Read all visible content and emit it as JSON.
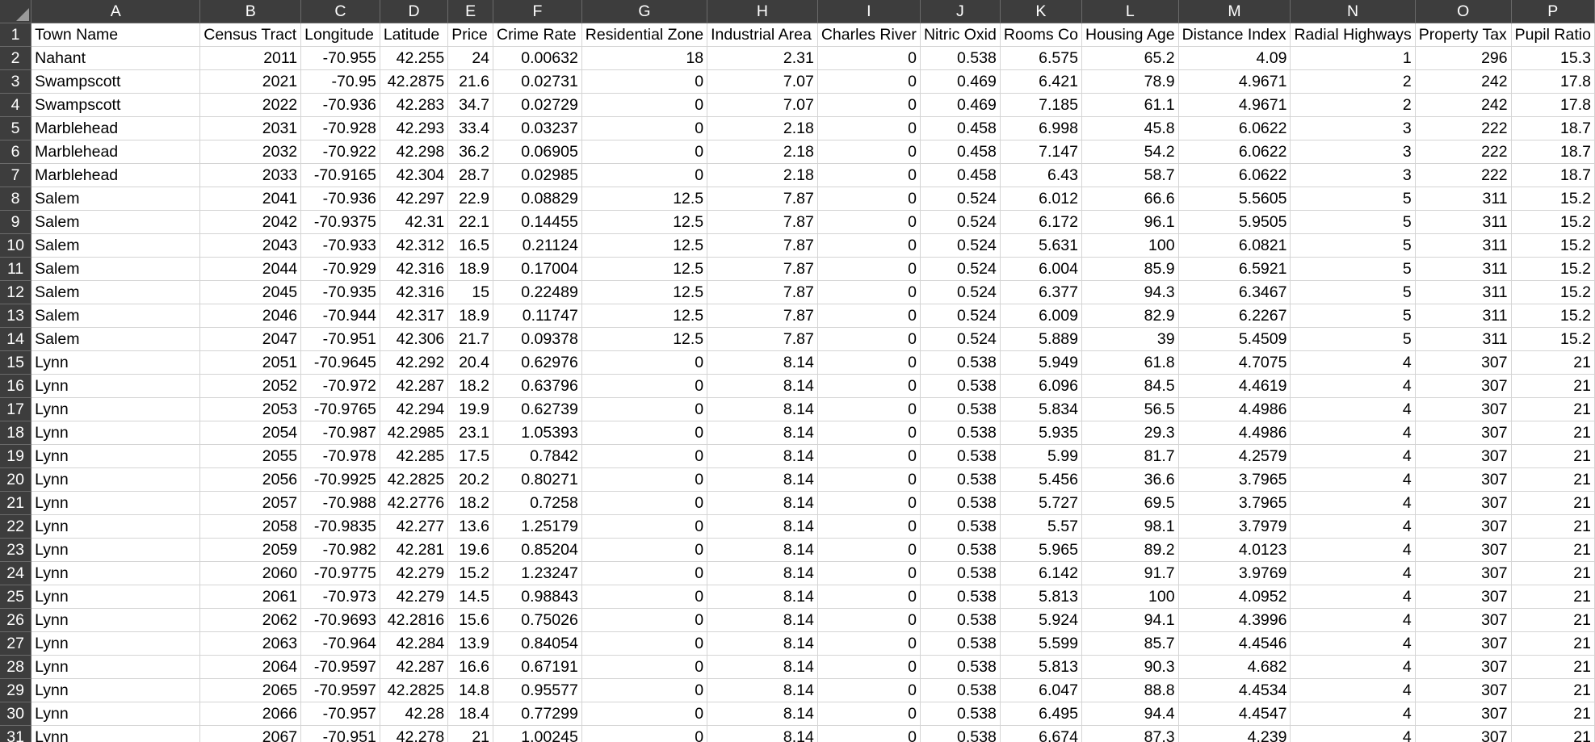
{
  "sheet": {
    "corner": "",
    "columns": [
      "A",
      "B",
      "C",
      "D",
      "E",
      "F",
      "G",
      "H",
      "I",
      "J",
      "K",
      "L",
      "M",
      "N",
      "O",
      "P"
    ],
    "rows": [
      [
        "Town Name",
        "Census Tract",
        "Longitude",
        "Latitude",
        "Price",
        "Crime Rate",
        "Residential Zone",
        "Industrial Area",
        "Charles River",
        "Nitric Oxid",
        "Rooms Co",
        "Housing Age",
        "Distance Index",
        "Radial Highways",
        "Property Tax",
        "Pupil Ratio"
      ],
      [
        "Nahant",
        "2011",
        "-70.955",
        "42.255",
        "24",
        "0.00632",
        "18",
        "2.31",
        "0",
        "0.538",
        "6.575",
        "65.2",
        "4.09",
        "1",
        "296",
        "15.3"
      ],
      [
        "Swampscott",
        "2021",
        "-70.95",
        "42.2875",
        "21.6",
        "0.02731",
        "0",
        "7.07",
        "0",
        "0.469",
        "6.421",
        "78.9",
        "4.9671",
        "2",
        "242",
        "17.8"
      ],
      [
        "Swampscott",
        "2022",
        "-70.936",
        "42.283",
        "34.7",
        "0.02729",
        "0",
        "7.07",
        "0",
        "0.469",
        "7.185",
        "61.1",
        "4.9671",
        "2",
        "242",
        "17.8"
      ],
      [
        "Marblehead",
        "2031",
        "-70.928",
        "42.293",
        "33.4",
        "0.03237",
        "0",
        "2.18",
        "0",
        "0.458",
        "6.998",
        "45.8",
        "6.0622",
        "3",
        "222",
        "18.7"
      ],
      [
        "Marblehead",
        "2032",
        "-70.922",
        "42.298",
        "36.2",
        "0.06905",
        "0",
        "2.18",
        "0",
        "0.458",
        "7.147",
        "54.2",
        "6.0622",
        "3",
        "222",
        "18.7"
      ],
      [
        "Marblehead",
        "2033",
        "-70.9165",
        "42.304",
        "28.7",
        "0.02985",
        "0",
        "2.18",
        "0",
        "0.458",
        "6.43",
        "58.7",
        "6.0622",
        "3",
        "222",
        "18.7"
      ],
      [
        "Salem",
        "2041",
        "-70.936",
        "42.297",
        "22.9",
        "0.08829",
        "12.5",
        "7.87",
        "0",
        "0.524",
        "6.012",
        "66.6",
        "5.5605",
        "5",
        "311",
        "15.2"
      ],
      [
        "Salem",
        "2042",
        "-70.9375",
        "42.31",
        "22.1",
        "0.14455",
        "12.5",
        "7.87",
        "0",
        "0.524",
        "6.172",
        "96.1",
        "5.9505",
        "5",
        "311",
        "15.2"
      ],
      [
        "Salem",
        "2043",
        "-70.933",
        "42.312",
        "16.5",
        "0.21124",
        "12.5",
        "7.87",
        "0",
        "0.524",
        "5.631",
        "100",
        "6.0821",
        "5",
        "311",
        "15.2"
      ],
      [
        "Salem",
        "2044",
        "-70.929",
        "42.316",
        "18.9",
        "0.17004",
        "12.5",
        "7.87",
        "0",
        "0.524",
        "6.004",
        "85.9",
        "6.5921",
        "5",
        "311",
        "15.2"
      ],
      [
        "Salem",
        "2045",
        "-70.935",
        "42.316",
        "15",
        "0.22489",
        "12.5",
        "7.87",
        "0",
        "0.524",
        "6.377",
        "94.3",
        "6.3467",
        "5",
        "311",
        "15.2"
      ],
      [
        "Salem",
        "2046",
        "-70.944",
        "42.317",
        "18.9",
        "0.11747",
        "12.5",
        "7.87",
        "0",
        "0.524",
        "6.009",
        "82.9",
        "6.2267",
        "5",
        "311",
        "15.2"
      ],
      [
        "Salem",
        "2047",
        "-70.951",
        "42.306",
        "21.7",
        "0.09378",
        "12.5",
        "7.87",
        "0",
        "0.524",
        "5.889",
        "39",
        "5.4509",
        "5",
        "311",
        "15.2"
      ],
      [
        "Lynn",
        "2051",
        "-70.9645",
        "42.292",
        "20.4",
        "0.62976",
        "0",
        "8.14",
        "0",
        "0.538",
        "5.949",
        "61.8",
        "4.7075",
        "4",
        "307",
        "21"
      ],
      [
        "Lynn",
        "2052",
        "-70.972",
        "42.287",
        "18.2",
        "0.63796",
        "0",
        "8.14",
        "0",
        "0.538",
        "6.096",
        "84.5",
        "4.4619",
        "4",
        "307",
        "21"
      ],
      [
        "Lynn",
        "2053",
        "-70.9765",
        "42.294",
        "19.9",
        "0.62739",
        "0",
        "8.14",
        "0",
        "0.538",
        "5.834",
        "56.5",
        "4.4986",
        "4",
        "307",
        "21"
      ],
      [
        "Lynn",
        "2054",
        "-70.987",
        "42.2985",
        "23.1",
        "1.05393",
        "0",
        "8.14",
        "0",
        "0.538",
        "5.935",
        "29.3",
        "4.4986",
        "4",
        "307",
        "21"
      ],
      [
        "Lynn",
        "2055",
        "-70.978",
        "42.285",
        "17.5",
        "0.7842",
        "0",
        "8.14",
        "0",
        "0.538",
        "5.99",
        "81.7",
        "4.2579",
        "4",
        "307",
        "21"
      ],
      [
        "Lynn",
        "2056",
        "-70.9925",
        "42.2825",
        "20.2",
        "0.80271",
        "0",
        "8.14",
        "0",
        "0.538",
        "5.456",
        "36.6",
        "3.7965",
        "4",
        "307",
        "21"
      ],
      [
        "Lynn",
        "2057",
        "-70.988",
        "42.2776",
        "18.2",
        "0.7258",
        "0",
        "8.14",
        "0",
        "0.538",
        "5.727",
        "69.5",
        "3.7965",
        "4",
        "307",
        "21"
      ],
      [
        "Lynn",
        "2058",
        "-70.9835",
        "42.277",
        "13.6",
        "1.25179",
        "0",
        "8.14",
        "0",
        "0.538",
        "5.57",
        "98.1",
        "3.7979",
        "4",
        "307",
        "21"
      ],
      [
        "Lynn",
        "2059",
        "-70.982",
        "42.281",
        "19.6",
        "0.85204",
        "0",
        "8.14",
        "0",
        "0.538",
        "5.965",
        "89.2",
        "4.0123",
        "4",
        "307",
        "21"
      ],
      [
        "Lynn",
        "2060",
        "-70.9775",
        "42.279",
        "15.2",
        "1.23247",
        "0",
        "8.14",
        "0",
        "0.538",
        "6.142",
        "91.7",
        "3.9769",
        "4",
        "307",
        "21"
      ],
      [
        "Lynn",
        "2061",
        "-70.973",
        "42.279",
        "14.5",
        "0.98843",
        "0",
        "8.14",
        "0",
        "0.538",
        "5.813",
        "100",
        "4.0952",
        "4",
        "307",
        "21"
      ],
      [
        "Lynn",
        "2062",
        "-70.9693",
        "42.2816",
        "15.6",
        "0.75026",
        "0",
        "8.14",
        "0",
        "0.538",
        "5.924",
        "94.1",
        "4.3996",
        "4",
        "307",
        "21"
      ],
      [
        "Lynn",
        "2063",
        "-70.964",
        "42.284",
        "13.9",
        "0.84054",
        "0",
        "8.14",
        "0",
        "0.538",
        "5.599",
        "85.7",
        "4.4546",
        "4",
        "307",
        "21"
      ],
      [
        "Lynn",
        "2064",
        "-70.9597",
        "42.287",
        "16.6",
        "0.67191",
        "0",
        "8.14",
        "0",
        "0.538",
        "5.813",
        "90.3",
        "4.682",
        "4",
        "307",
        "21"
      ],
      [
        "Lynn",
        "2065",
        "-70.9597",
        "42.2825",
        "14.8",
        "0.95577",
        "0",
        "8.14",
        "0",
        "0.538",
        "6.047",
        "88.8",
        "4.4534",
        "4",
        "307",
        "21"
      ],
      [
        "Lynn",
        "2066",
        "-70.957",
        "42.28",
        "18.4",
        "0.77299",
        "0",
        "8.14",
        "0",
        "0.538",
        "6.495",
        "94.4",
        "4.4547",
        "4",
        "307",
        "21"
      ],
      [
        "Lynn",
        "2067",
        "-70.951",
        "42.278",
        "21",
        "1.00245",
        "0",
        "8.14",
        "0",
        "0.538",
        "6.674",
        "87.3",
        "4.239",
        "4",
        "307",
        "21"
      ]
    ]
  }
}
